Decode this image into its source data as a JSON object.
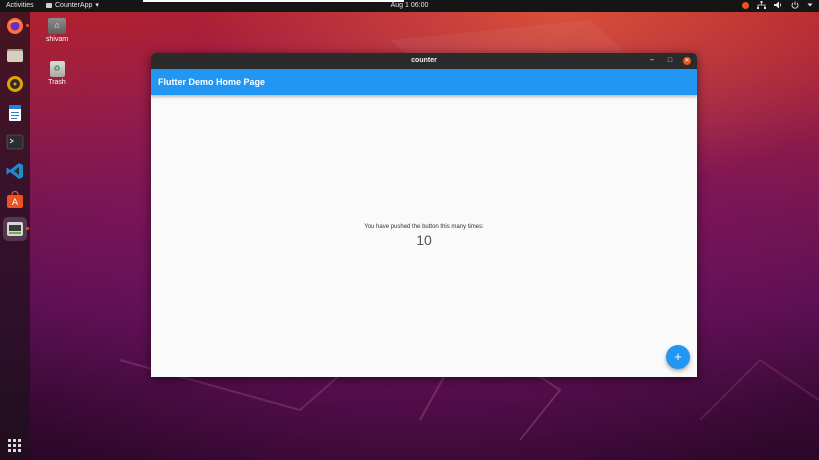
{
  "topbar": {
    "activities": "Activities",
    "app_name": "CounterApp",
    "app_menu_arrow": "▾",
    "clock": "Aug 1  06:00",
    "tray_icons": [
      "notification-icon",
      "network-icon",
      "volume-icon",
      "power-icon",
      "menu-arrow-icon"
    ]
  },
  "dock": {
    "items": [
      {
        "icon": "firefox-icon",
        "color": "#ff7139"
      },
      {
        "icon": "files-icon",
        "color": "#cfc6b4"
      },
      {
        "icon": "rhythmbox-icon",
        "color": "#e0a400"
      },
      {
        "icon": "writer-icon",
        "color": "#2a7fd4"
      },
      {
        "icon": "terminal-icon",
        "color": "#2d2d2d"
      },
      {
        "icon": "vscode-icon",
        "color": "#1f8ad2"
      },
      {
        "icon": "software-center-icon",
        "color": "#e95420"
      },
      {
        "icon": "counter-app-icon",
        "color": "#d7d7d7"
      }
    ],
    "show_apps_icon": "grid-icon"
  },
  "desktop": {
    "home_label": "shivam",
    "trash_label": "Trash"
  },
  "window": {
    "title": "counter",
    "minimize_glyph": "–",
    "maximize_glyph": "□",
    "close_glyph": "✕",
    "app_bar_title": "Flutter Demo Home Page",
    "message": "You have pushed the button this many times:",
    "counter": "10",
    "fab_glyph": "+",
    "accent": "#2196f3",
    "close_color": "#e95420"
  }
}
